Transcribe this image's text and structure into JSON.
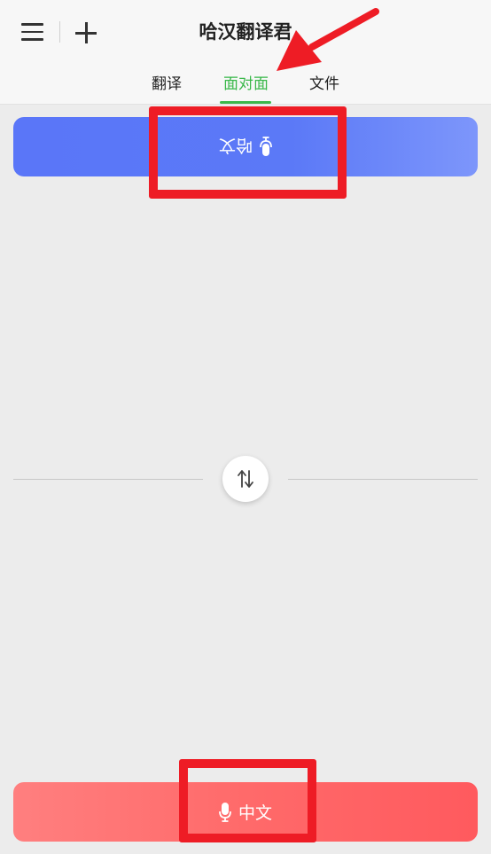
{
  "header": {
    "title": "哈汉翻译君",
    "menu_icon": "hamburger-menu-icon",
    "add_icon": "plus-icon",
    "tabs": [
      {
        "label": "翻译",
        "active": false
      },
      {
        "label": "面对面",
        "active": true
      },
      {
        "label": "文件",
        "active": false
      }
    ],
    "active_color": "#3ab84a"
  },
  "top_language_button": {
    "label": "哈文",
    "icon": "microphone-icon",
    "orientation": "upside-down",
    "color": "#5b79f7"
  },
  "swap_button": {
    "icon": "swap-arrows-icon"
  },
  "bottom_language_button": {
    "label": "中文",
    "icon": "microphone-icon",
    "color": "#ff6a6a"
  },
  "annotations": {
    "highlight_color": "#ee1c25",
    "arrow_target": "面对面"
  }
}
